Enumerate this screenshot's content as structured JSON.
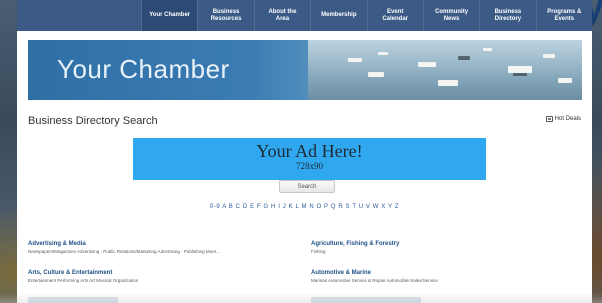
{
  "nav": {
    "items": [
      {
        "label": "Your Chamber",
        "active": true
      },
      {
        "label": "Business\nResources",
        "active": false
      },
      {
        "label": "About the\nArea",
        "active": false
      },
      {
        "label": "Membership",
        "active": false
      },
      {
        "label": "Event\nCalendar",
        "active": false
      },
      {
        "label": "Community\nNews",
        "active": false
      },
      {
        "label": "Business\nDirectory",
        "active": false
      },
      {
        "label": "Programs &\nEvents",
        "active": false
      }
    ]
  },
  "banner": {
    "title": "Your Chamber"
  },
  "page": {
    "title": "Business Directory Search",
    "hot_deals": "Hot Deals"
  },
  "ad": {
    "title": "Your Ad Here!",
    "size": "728x90"
  },
  "search": {
    "button": "Search"
  },
  "alphabet": "0-9 A B C D E F G H I J K L M N O P Q R S T U V W X Y Z",
  "categories": [
    {
      "title": "Advertising & Media",
      "subs": "Newspapers/Magazines  Advertising - Public Relations/Marketing  Advertising - Publishing  More..."
    },
    {
      "title": "Agriculture, Fishing & Forestry",
      "subs": "Fishing"
    },
    {
      "title": "Arts, Culture & Entertainment",
      "subs": "Entertainment  Performing Arts  Art  Musical Organization"
    },
    {
      "title": "Automotive & Marine",
      "subs": "Marinas  Automotive Service & Repair  Automobile Sales/Service"
    }
  ],
  "colors": {
    "nav": "#3b5b86",
    "ad": "#2fa8ef",
    "link": "#1d4f86",
    "corner": "#1a3f73"
  }
}
